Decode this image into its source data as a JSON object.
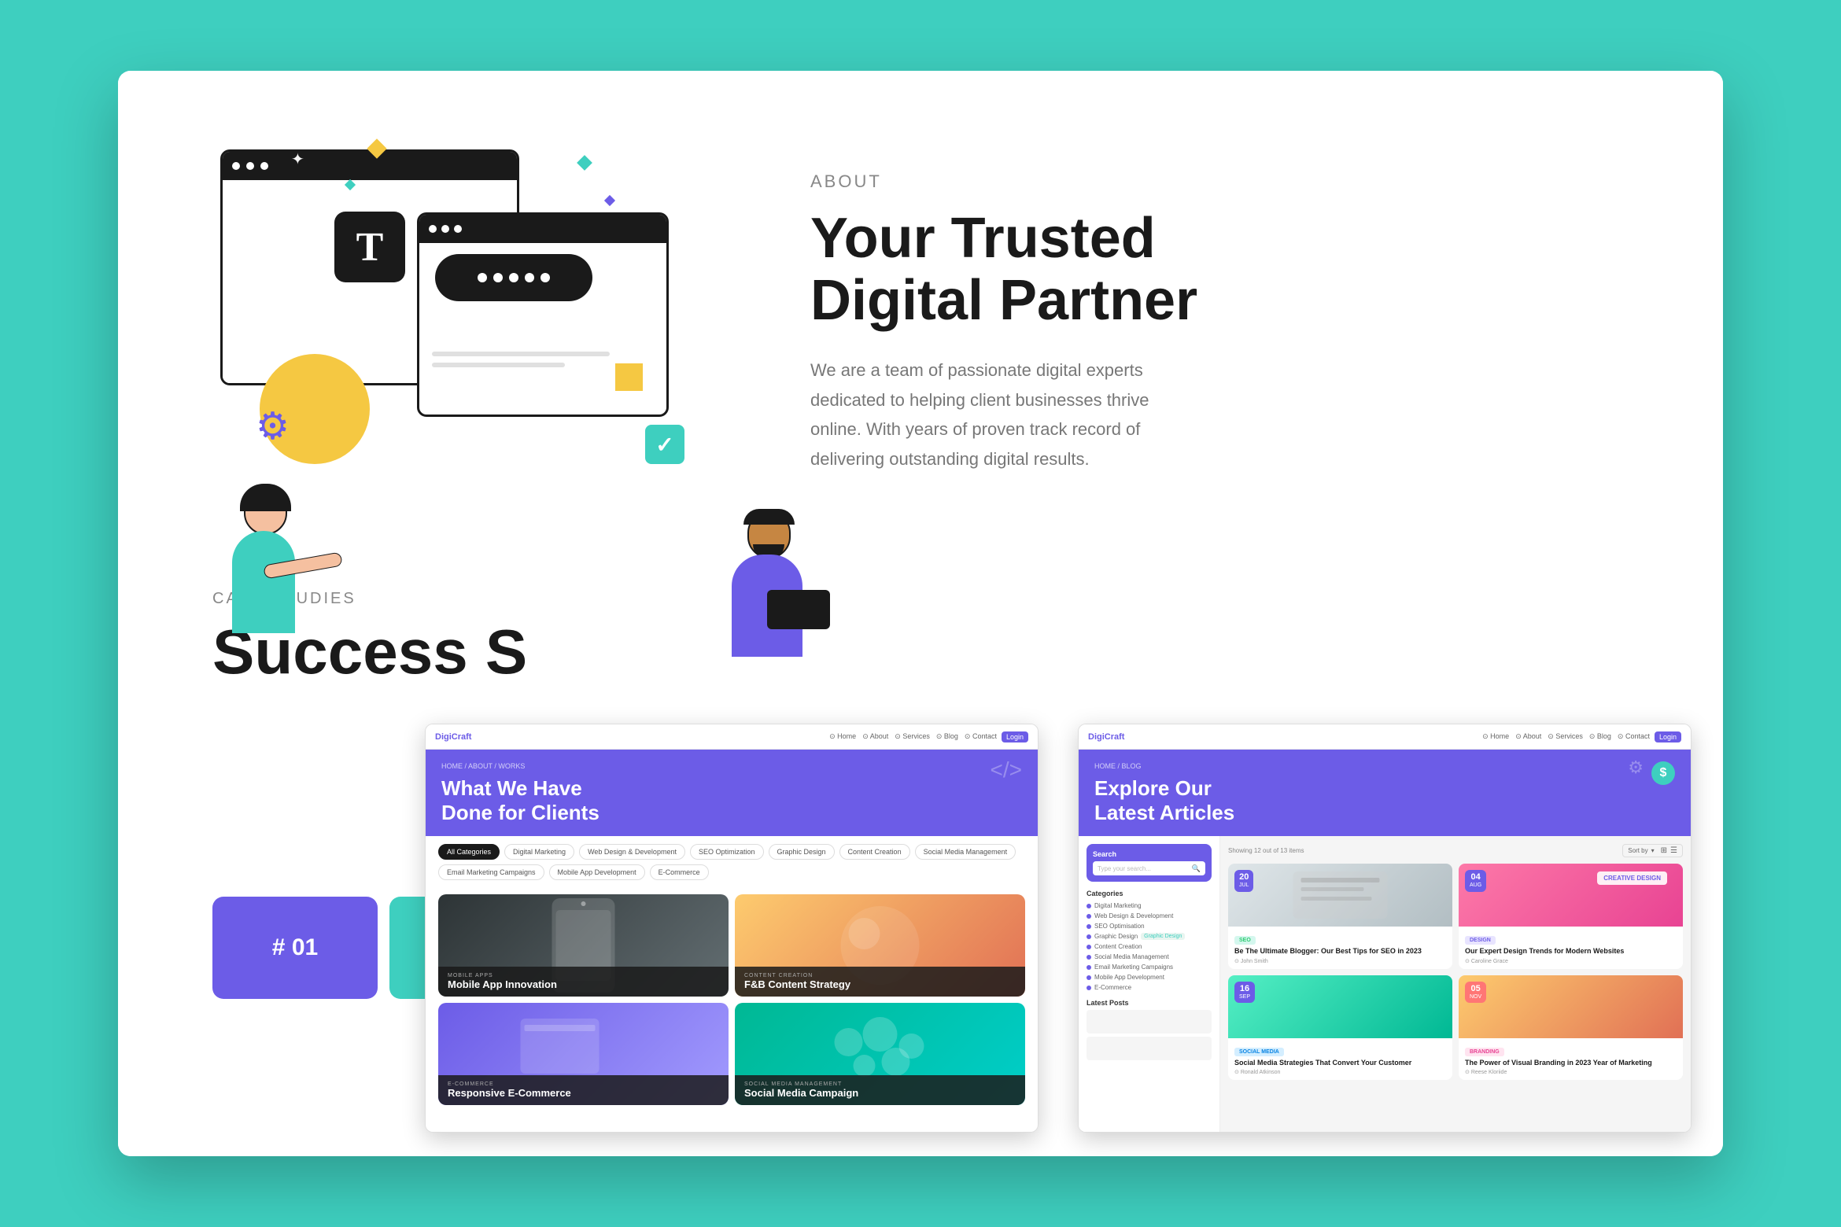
{
  "page": {
    "bg_color": "#3ecfbf"
  },
  "about": {
    "label": "ABOUT",
    "title_line1": "Your Trusted",
    "title_line2": "Digital Partner",
    "description": "We are a team of passionate digital experts dedicated to helping client businesses thrive online. With years of proven track record of delivering outstanding digital results."
  },
  "case_studies": {
    "label": "CASE STUDIES",
    "title": "Success S",
    "number": "# 01"
  },
  "portfolio_browser": {
    "nav_logo": "DigiCraft",
    "nav_links": [
      "Home",
      "About",
      "Services",
      "Blog",
      "Contact"
    ],
    "nav_btn": "Login",
    "breadcrumb": "HOME / ABOUT / WORKS",
    "title_line1": "What We Have",
    "title_line2": "Done for Clients",
    "filters": [
      {
        "label": "All Categories",
        "active": true
      },
      {
        "label": "Digital Marketing",
        "active": false
      },
      {
        "label": "Web Design & Development",
        "active": false
      },
      {
        "label": "SEO Optimization",
        "active": false
      },
      {
        "label": "Graphic Design",
        "active": false
      },
      {
        "label": "Content Creation",
        "active": false
      },
      {
        "label": "Social Media Management",
        "active": false
      },
      {
        "label": "Email Marketing Campaigns",
        "active": false
      },
      {
        "label": "Mobile App Development",
        "active": false
      },
      {
        "label": "E-Commerce",
        "active": false
      }
    ],
    "items": [
      {
        "category": "MOBILE APPS",
        "title": "Mobile App Innovation",
        "bg": "dark"
      },
      {
        "category": "CONTENT CREATION",
        "title": "F&B Content Strategy",
        "bg": "food"
      },
      {
        "category": "E-COMMERCE",
        "title": "Responsive E-Commerce",
        "bg": "ecommerce"
      },
      {
        "category": "SOCIAL MEDIA MANAGEMENT",
        "title": "Social Media Campaign",
        "bg": "social"
      }
    ]
  },
  "blog_browser": {
    "nav_logo": "DigiCraft",
    "nav_links": [
      "Home",
      "About",
      "Services",
      "Blog",
      "Contact"
    ],
    "nav_btn": "Login",
    "breadcrumb": "HOME / BLOG",
    "title_line1": "Explore Our",
    "title_line2": "Latest Articles",
    "search_placeholder": "Type your search...",
    "search_label": "Search",
    "result_count": "Showing 12 out of 13 items",
    "sort_label": "Sort by",
    "categories_title": "Categories",
    "categories": [
      "Digital Marketing",
      "Web Design & Development",
      "SEO Optimisation",
      "Graphic Design",
      "Content Creation",
      "Social Media Management",
      "Email Marketing Campaigns",
      "Mobile App Development",
      "E-Commerce"
    ],
    "latest_posts_title": "Latest Posts",
    "articles": [
      {
        "date_num": "20",
        "date_mon": "JUL",
        "tag": "SEO",
        "tag_class": "tag-seo",
        "title": "Be The Ultimate Blogger: Our Best Tips for SEO in 2023",
        "author": "John Smith",
        "img_class": "blog-img-1"
      },
      {
        "date_num": "04",
        "date_mon": "AUG",
        "tag": "DESIGN",
        "tag_class": "tag-design",
        "title": "Our Expert Design Trends for Modern Websites",
        "author": "Caroline Grace",
        "img_class": "blog-img-2"
      },
      {
        "date_num": "16",
        "date_mon": "SEP",
        "tag": "SOCIAL MEDIA",
        "tag_class": "tag-social",
        "title": "Social Media Strategies That Convert Your Customer",
        "author": "Ronald Atkinson",
        "img_class": "blog-img-3"
      },
      {
        "date_num": "05",
        "date_mon": "NOV",
        "tag": "BRANDING",
        "tag_class": "tag-branding",
        "title": "The Power of Visual Branding in 2023 Year of Marketing",
        "author": "Reese Kloriide",
        "img_class": "blog-img-4"
      }
    ]
  }
}
